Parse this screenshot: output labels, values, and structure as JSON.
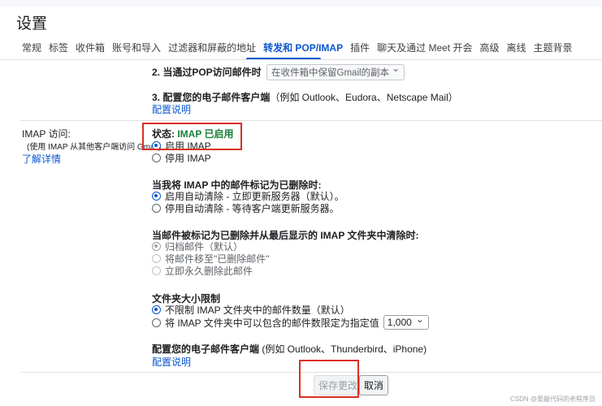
{
  "page": {
    "title": "设置"
  },
  "tabs": [
    {
      "label": "常规"
    },
    {
      "label": "标签"
    },
    {
      "label": "收件箱"
    },
    {
      "label": "账号和导入"
    },
    {
      "label": "过滤器和屏蔽的地址"
    },
    {
      "label": "转发和 POP/IMAP",
      "active": true
    },
    {
      "label": "插件"
    },
    {
      "label": "聊天及通过 Meet 开会"
    },
    {
      "label": "高级"
    },
    {
      "label": "离线"
    },
    {
      "label": "主题背景"
    }
  ],
  "pop": {
    "item2_label": "2. 当通过POP访问邮件时",
    "item2_select": "在收件箱中保留Gmail的副本",
    "item3_label": "3. 配置您的电子邮件客户端",
    "item3_note": "（例如 Outlook、Eudora、Netscape Mail）",
    "item3_link": "配置说明"
  },
  "imap": {
    "heading": "IMAP 访问:",
    "subheading": "(使用 IMAP 从其他客户端访问 Gmail)",
    "learn_more": "了解详情",
    "status_label": "状态: ",
    "status_value": "IMAP 已启用",
    "status_color": "#188038",
    "enable": "启用 IMAP",
    "disable": "停用 IMAP",
    "deleted_title": "当我将 IMAP 中的邮件标记为已删除时:",
    "deleted_opt1": "启用自动清除 - 立即更新服务器（默认）。",
    "deleted_opt2": "停用自动清除 - 等待客户端更新服务器。",
    "expunge_title": "当邮件被标记为已删除并从最后显示的 IMAP 文件夹中清除时:",
    "expunge_opt1": "归档邮件（默认）",
    "expunge_opt2": "将邮件移至\"已删除邮件\"",
    "expunge_opt3": "立即永久删除此邮件",
    "folder_title": "文件夹大小限制",
    "folder_opt1": "不限制 IMAP 文件夹中的邮件数量（默认）",
    "folder_opt2": "将 IMAP 文件夹中可以包含的邮件数限定为指定值",
    "folder_select": "1,000",
    "client_title": "配置您的电子邮件客户端",
    "client_note": " (例如 Outlook、Thunderbird、iPhone)",
    "client_link": "配置说明"
  },
  "buttons": {
    "save": "保存更改",
    "cancel": "取消"
  },
  "colors": {
    "accent": "#0b57d0",
    "annotation": "#d93025"
  },
  "watermark": "CSDN @爱敲代码的老程序员"
}
